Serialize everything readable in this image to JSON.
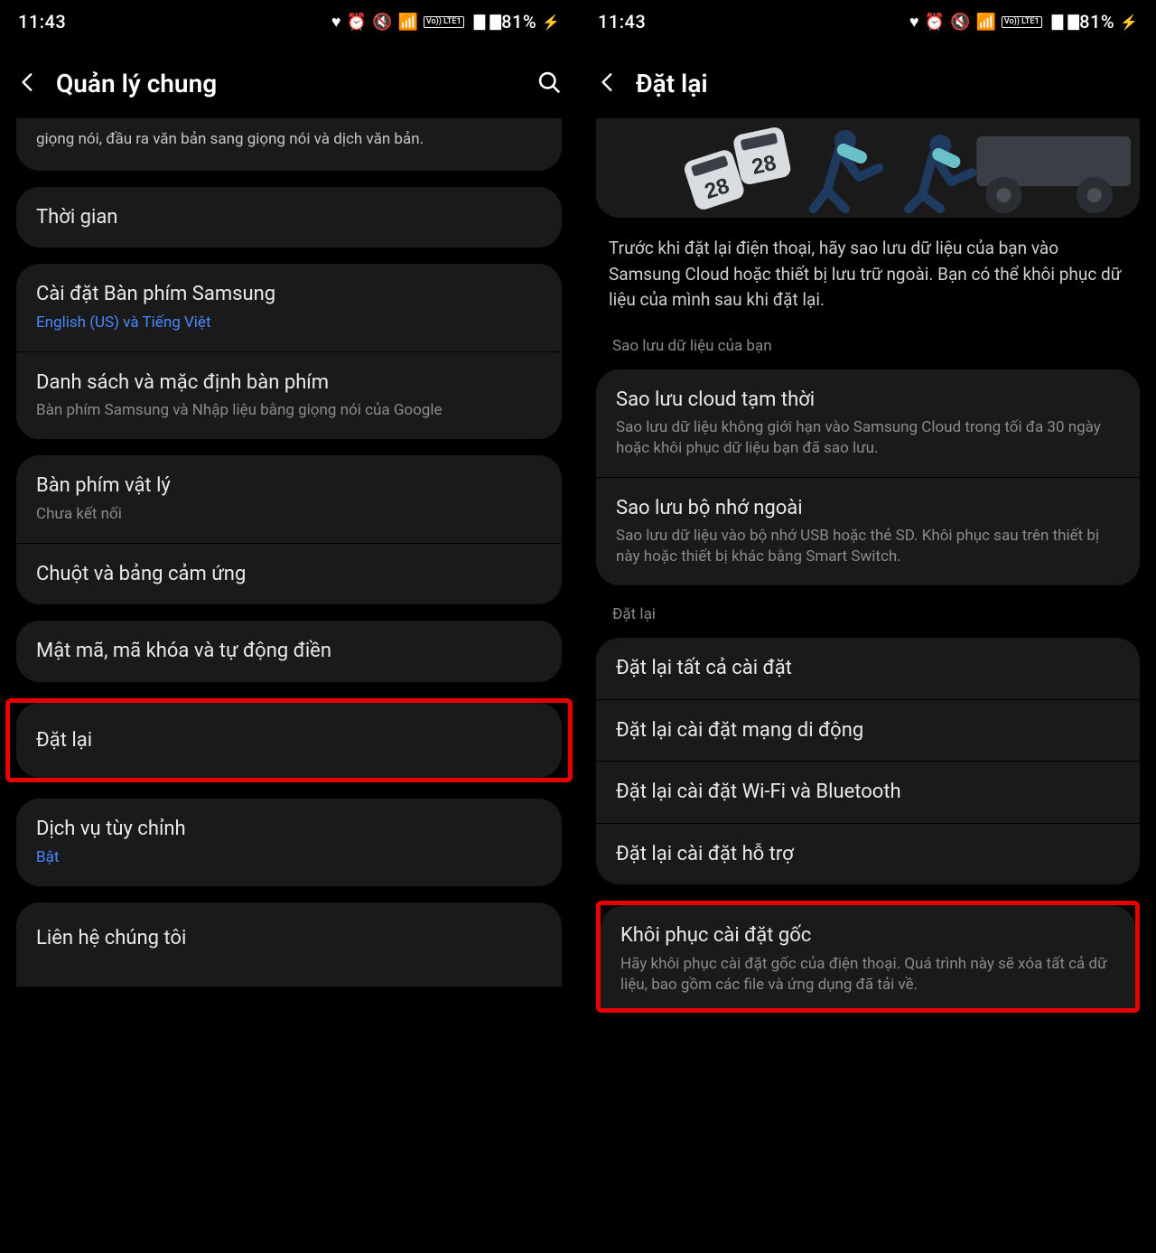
{
  "status": {
    "time": "11:43",
    "battery": "81%",
    "lte": "Vo)) LTE1"
  },
  "left": {
    "title": "Quản lý chung",
    "partial": "giọng nói, đầu ra văn bản sang giọng nói và dịch văn bản.",
    "items": {
      "time": "Thời gian",
      "kb_samsung": "Cài đặt Bàn phím Samsung",
      "kb_samsung_sub": "English (US) và Tiếng Việt",
      "kb_list": "Danh sách và mặc định bàn phím",
      "kb_list_sub": "Bàn phím Samsung và Nhập liệu bằng giọng nói của Google",
      "phys_kb": "Bàn phím vật lý",
      "phys_kb_sub": "Chưa kết nối",
      "mouse": "Chuột và bảng cảm ứng",
      "passwords": "Mật mã, mã khóa và tự động điền",
      "reset": "Đặt lại",
      "custom_service": "Dịch vụ tùy chỉnh",
      "custom_service_sub": "Bật",
      "contact": "Liên hệ chúng tôi"
    }
  },
  "right": {
    "title": "Đặt lại",
    "desc": "Trước khi đặt lại điện thoại, hãy sao lưu dữ liệu của bạn vào Samsung Cloud hoặc thiết bị lưu trữ ngoài. Bạn có thể khôi phục dữ liệu của mình sau khi đặt lại.",
    "section_backup": "Sao lưu dữ liệu của bạn",
    "backup_cloud": "Sao lưu cloud tạm thời",
    "backup_cloud_sub": "Sao lưu dữ liệu không giới hạn vào Samsung Cloud trong tối đa 30 ngày hoặc khôi phục dữ liệu bạn đã sao lưu.",
    "backup_ext": "Sao lưu bộ nhớ ngoài",
    "backup_ext_sub": "Sao lưu dữ liệu vào bộ nhớ USB hoặc thẻ SD. Khôi phục sau trên thiết bị này hoặc thiết bị khác bằng Smart Switch.",
    "section_reset": "Đặt lại",
    "reset_all": "Đặt lại tất cả cài đặt",
    "reset_mobile": "Đặt lại cài đặt mạng di động",
    "reset_wifi": "Đặt lại cài đặt Wi-Fi và Bluetooth",
    "reset_support": "Đặt lại cài đặt hỗ trợ",
    "factory": "Khôi phục cài đặt gốc",
    "factory_sub": "Hãy khôi phục cài đặt gốc của điện thoại. Quá trình này sẽ xóa tất cả dữ liệu, bao gồm các file và ứng dụng đã tải về."
  }
}
